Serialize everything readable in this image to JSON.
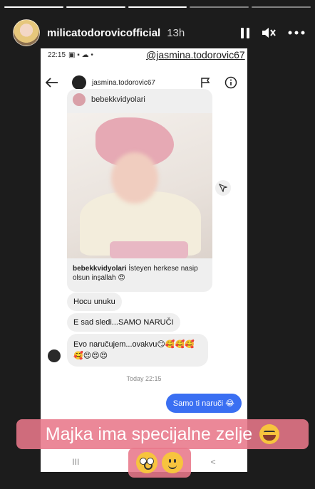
{
  "story": {
    "username": "milicatodorovicofficial",
    "time_ago": "13h",
    "segments_done": 3,
    "segments_total": 5
  },
  "mention": "@jasmina.todorovic67",
  "phone_status": {
    "time": "22:15"
  },
  "dm": {
    "contact": "jasmina.todorovic67",
    "shared_post": {
      "username": "bebekkvidyolari",
      "caption_user": "bebekkvidyolari",
      "caption_text": " İsteyen herkese nasip olsun inşallah 😍"
    },
    "messages": [
      "Hocu unuku",
      "E sad sledi...SAMO NARUČI",
      "Evo naručujem...ovakvu😏🥰🥰🥰🥰😍😍😍"
    ],
    "timestamp": "Today 22:15",
    "my_message": "Samo ti naruči 😂"
  },
  "overlay": {
    "text": "Majka ima specijalne zelje"
  },
  "nav": [
    "III",
    "○",
    "<"
  ]
}
